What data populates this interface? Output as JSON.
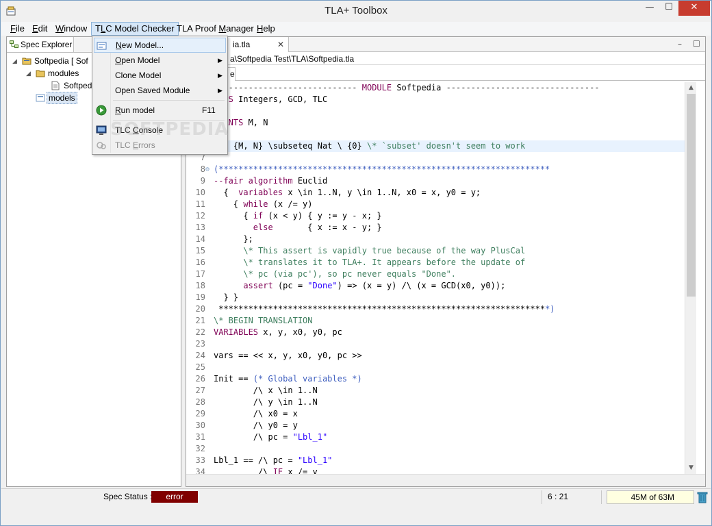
{
  "window": {
    "title": "TLA+ Toolbox",
    "minimize_glyph": "—",
    "maximize_glyph": "☐",
    "close_glyph": "✕"
  },
  "menubar": {
    "items": [
      "File",
      "Edit",
      "Window",
      "TLC Model Checker",
      "TLA Proof Manager",
      "Help"
    ],
    "active_index": 3
  },
  "spec_explorer": {
    "tab_label": "Spec Explorer",
    "tree": [
      {
        "label": "Softpedia [ Sof",
        "depth": 0,
        "expanded": true
      },
      {
        "label": "modules",
        "depth": 1,
        "expanded": true
      },
      {
        "label": "Softped",
        "depth": 2
      },
      {
        "label": "models",
        "depth": 1,
        "selected": true
      }
    ]
  },
  "editor": {
    "tab_label": "ia.tla",
    "close_glyph": "✕",
    "min_glyph": "–",
    "max_glyph": "☐",
    "path": "a\\Softpedia Test\\TLA\\Softpedia.tla",
    "subtab_label": "e",
    "current_line": 6
  },
  "code_lines": [
    {
      "n": "",
      "html": "<span>----------------------------- </span><span class=\"k\">MODULE</span><span> Softpedia -------------------------------</span>"
    },
    {
      "n": "",
      "html": "<span class=\"k\">ENDS</span><span> Integers, GCD, TLC</span>"
    },
    {
      "n": "",
      "html": ""
    },
    {
      "n": "",
      "html": "<span class=\"k\">STANTS</span><span> M, N</span>"
    },
    {
      "n": "",
      "html": ""
    },
    {
      "n": "",
      "html": "<span class=\"k\">UME</span><span> {M, N} \\subseteq Nat \\ {0} </span><span class=\"c\">\\* `subset' doesn't seem to work</span>"
    },
    {
      "n": "7",
      "html": ""
    },
    {
      "n": "8",
      "fold": true,
      "html": "<span class=\"b\">(*******************************************************************</span>"
    },
    {
      "n": "9",
      "html": "<span class=\"k\">--fair algorithm</span><span> Euclid</span>"
    },
    {
      "n": "10",
      "html": "<span>  {  </span><span class=\"k\">variables</span><span> x \\in 1..N, y \\in 1..N, x0 = x, y0 = y;</span>"
    },
    {
      "n": "11",
      "html": "<span>    { </span><span class=\"k\">while</span><span> (x /= y)</span>"
    },
    {
      "n": "12",
      "html": "<span>      { </span><span class=\"k\">if</span><span> (x &lt; y) { y := y - x; }</span>"
    },
    {
      "n": "13",
      "html": "<span>        </span><span class=\"k\">else</span><span>       { x := x - y; }</span>"
    },
    {
      "n": "14",
      "html": "<span>      };</span>"
    },
    {
      "n": "15",
      "html": "<span>      </span><span class=\"c\">\\* This assert is vapidly true because of the way PlusCal</span>"
    },
    {
      "n": "16",
      "html": "<span>      </span><span class=\"c\">\\* translates it to TLA+. It appears before the update of</span>"
    },
    {
      "n": "17",
      "html": "<span>      </span><span class=\"c\">\\* pc (via pc'), so pc never equals \"Done\".</span>"
    },
    {
      "n": "18",
      "html": "<span>      </span><span class=\"k\">assert</span><span> (pc = </span><span class=\"s\">\"Done\"</span><span>) =&gt; (x = y) /\\ (x = GCD(x0, y0));</span>"
    },
    {
      "n": "19",
      "html": "<span>  } }</span>"
    },
    {
      "n": "20",
      "html": "<span> ******************************************************************</span><span class=\"b\">*)</span>"
    },
    {
      "n": "21",
      "html": "<span class=\"c\">\\* BEGIN TRANSLATION</span>"
    },
    {
      "n": "22",
      "html": "<span class=\"k\">VARIABLES</span><span> x, y, x0, y0, pc</span>"
    },
    {
      "n": "23",
      "html": ""
    },
    {
      "n": "24",
      "html": "<span>vars == &lt;&lt; x, y, x0, y0, pc &gt;&gt;</span>"
    },
    {
      "n": "25",
      "html": ""
    },
    {
      "n": "26",
      "html": "<span>Init == </span><span class=\"b\">(* Global variables *)</span>"
    },
    {
      "n": "27",
      "html": "<span>        /\\ x \\in 1..N</span>"
    },
    {
      "n": "28",
      "html": "<span>        /\\ y \\in 1..N</span>"
    },
    {
      "n": "29",
      "html": "<span>        /\\ x0 = x</span>"
    },
    {
      "n": "30",
      "html": "<span>        /\\ y0 = y</span>"
    },
    {
      "n": "31",
      "html": "<span>        /\\ pc = </span><span class=\"s\">\"Lbl_1\"</span>"
    },
    {
      "n": "32",
      "html": ""
    },
    {
      "n": "33",
      "html": "<span>Lbl_1 == /\\ pc = </span><span class=\"s\">\"Lbl_1\"</span>"
    },
    {
      "n": "34",
      "html": "<span>         /\\ </span><span class=\"k\">IF</span><span> x /= y</span>"
    }
  ],
  "dropdown": {
    "items": [
      {
        "label": "New Model...",
        "mnemonic": "N",
        "icon": "new-model-icon",
        "selected": true
      },
      {
        "label": "Open Model",
        "mnemonic": "O",
        "submenu": true
      },
      {
        "label": "Clone Model",
        "mnemonic": "",
        "submenu": true
      },
      {
        "label": "Open Saved Module",
        "mnemonic": "",
        "submenu": true
      },
      {
        "separator": true
      },
      {
        "label": "Run model",
        "mnemonic": "R",
        "shortcut": "F11",
        "icon": "run-icon"
      },
      {
        "separator": true
      },
      {
        "label": "TLC Console",
        "mnemonic": "C",
        "icon": "console-icon"
      },
      {
        "label": "TLC Errors",
        "mnemonic": "E",
        "icon": "errors-icon",
        "disabled": true
      }
    ],
    "arrow_glyph": "▶"
  },
  "status": {
    "label": "Spec Status :",
    "value": "error",
    "error_color": "#800000",
    "cursor_pos": "6 : 21",
    "heap": "45M of 63M"
  },
  "watermark": "SOFTPEDIA"
}
